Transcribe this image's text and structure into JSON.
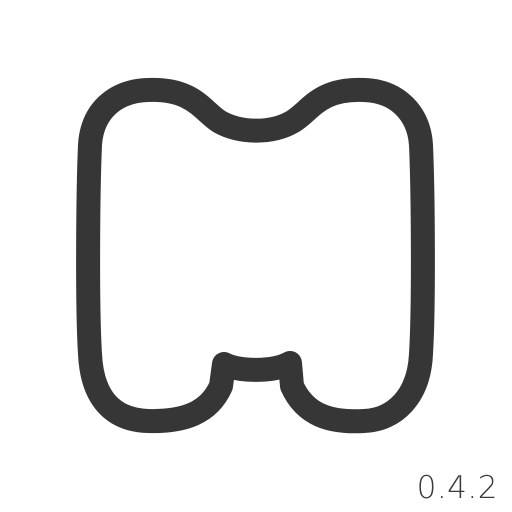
{
  "logo": {
    "icon": "rounded-m-outline-logo",
    "stroke_color": "#363636",
    "background": "#ffffff"
  },
  "version": {
    "text": "0.4.2"
  }
}
